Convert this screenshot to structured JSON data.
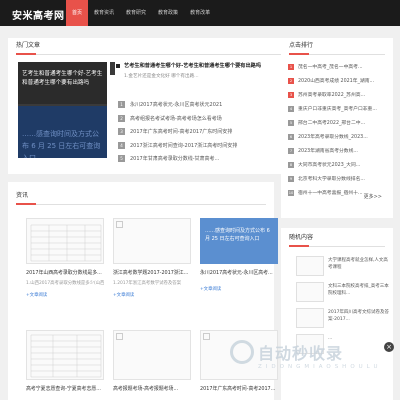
{
  "site": {
    "logo": "安米高考网"
  },
  "nav": [
    "首页",
    "教育资讯",
    "教育研究",
    "教育政策",
    "教育改革"
  ],
  "hot": {
    "title": "热门文章",
    "slide": {
      "caption1": "艺考生和普通考生哪个好-艺考生和普通考生哪个要有出路吗",
      "caption2": "……感查询时间及方式公布 6 月 25 日左右可查询入口"
    },
    "top": {
      "title": "艺考生和普通考生哪个好-艺考生和普通考生哪个要有出路吗",
      "sub": "1.金艺片还是金文化好 哪个有出路..."
    },
    "items": [
      "永川2017高考状元-永川区高考状元2021",
      "高考组报名考试考场-高考考场怎么看考场",
      "2017年广东高考时间-高考2017广东时间安排",
      "2017浙江高考时间查询-2017浙江高考时间安排",
      "2017年甘肃高考录取分数线-甘肃高考..."
    ]
  },
  "sidebar": {
    "title": "点击排行",
    "items": [
      "茂名一中高考_茂名一中高考...",
      "2020山西高考成绩 2021年_湖南...",
      "苏州高考录取率2022_苏州高...",
      "重庆户口非重庆高考_高考户口非重...",
      "邢台二中高考2022_邢台二中...",
      "2023年高考录取分数线_2023...",
      "2023年湖南省高考分数线...",
      "大同市高考状元2023_大同...",
      "北京考科大学录取分数线排名...",
      "宿州十一中高考喜报_宿州十..."
    ]
  },
  "news": {
    "title": "资讯",
    "more": "更多>>",
    "cards": [
      {
        "title": "2017年山西高考录取分数线是多...",
        "desc": "1.山西2017高考录取分数线是多少(山西...",
        "tag": "+文章阅读"
      },
      {
        "title": "浙江高考数学题2017-2017浙江...",
        "desc": "1.2017年浙江高考数学试卷及答案",
        "tag": "+文章阅读"
      },
      {
        "title": "永川2017高考状元-永川区高考...",
        "desc": "",
        "tag": "+文章阅读",
        "blue_text": "……感查询时间及方式公布 6 月 25 日左右可查询入口"
      },
      {
        "title": "高考宁夏志愿查询-宁夏高考志愿...",
        "desc": "",
        "tag": ""
      },
      {
        "title": "高考报题考场-高考报题考场...",
        "desc": "",
        "tag": ""
      },
      {
        "title": "2017年广东高考时间-高考2017...",
        "desc": "",
        "tag": ""
      }
    ]
  },
  "random": {
    "title": "随机内容",
    "items": [
      "大学课程高考就业怎样,人文高考课程",
      "文科三本院校高考排_高考三本院校理科...",
      "2017年四川高考文综试卷及答案-2017...",
      "..."
    ]
  },
  "watermark": {
    "main": "自动秒收录",
    "sub": "ZIDONGMIAOSHOULU"
  },
  "colors": {
    "accent": "#e8524a",
    "topbar": "#1b1b1b",
    "link": "#3a7bd5"
  }
}
